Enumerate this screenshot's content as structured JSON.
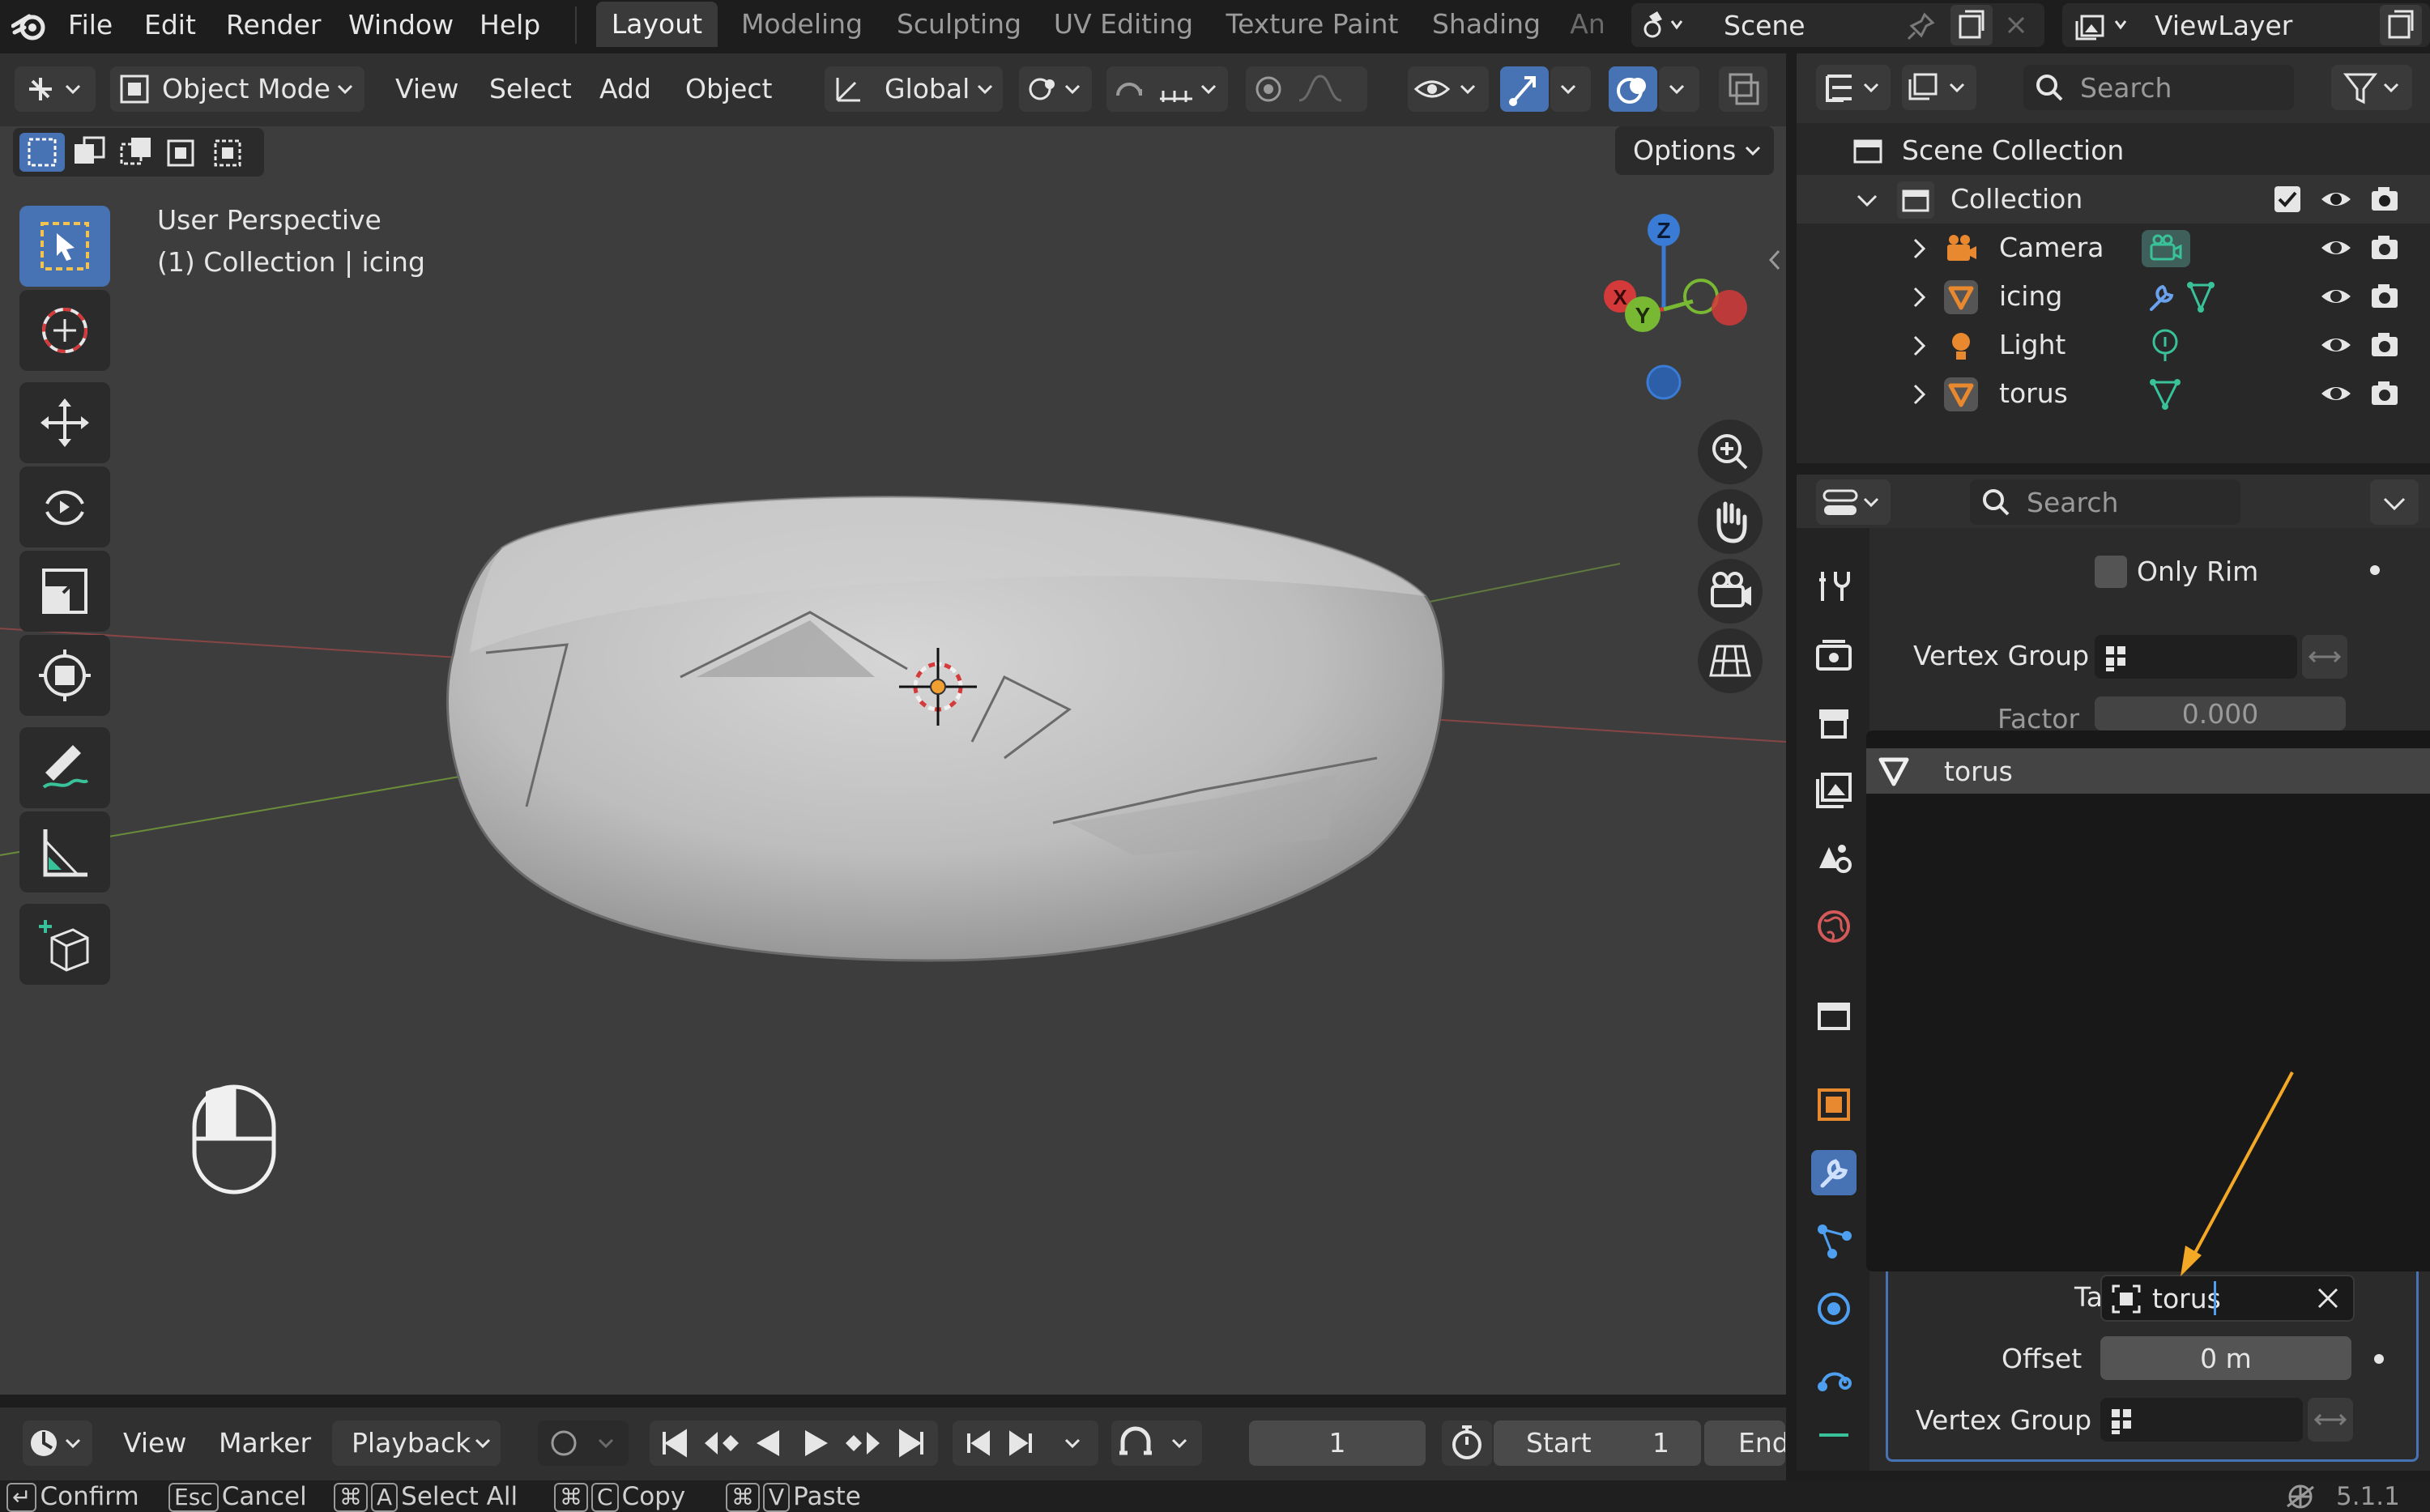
{
  "topbar": {
    "menus": [
      "File",
      "Edit",
      "Render",
      "Window",
      "Help"
    ],
    "workspaces": [
      "Layout",
      "Modeling",
      "Sculpting",
      "UV Editing",
      "Texture Paint",
      "Shading",
      "An"
    ],
    "scene_label": "Scene",
    "viewlayer_label": "ViewLayer"
  },
  "viewport_header": {
    "mode": "Object Mode",
    "menus": [
      "View",
      "Select",
      "Add",
      "Object"
    ],
    "orientation": "Global",
    "options": "Options"
  },
  "viewport": {
    "perspective": "User Perspective",
    "context": "(1) Collection | icing",
    "gizmo": {
      "z": "Z",
      "x": "X",
      "y": "Y"
    }
  },
  "outliner": {
    "search_placeholder": "Search",
    "scene_collection": "Scene Collection",
    "collection": "Collection",
    "items": [
      {
        "name": "Camera",
        "icon": "camera-object-icon",
        "data_icon": "camera-data-icon"
      },
      {
        "name": "icing",
        "icon": "mesh-object-icon",
        "data_icon": "modifier-wrench-icon"
      },
      {
        "name": "Light",
        "icon": "light-object-icon",
        "data_icon": "light-data-icon"
      },
      {
        "name": "torus",
        "icon": "mesh-object-icon",
        "data_icon": "mesh-data-icon"
      }
    ]
  },
  "properties": {
    "search_placeholder": "Search",
    "only_rim": "Only Rim",
    "vertex_group": "Vertex Group",
    "factor_label": "Factor",
    "factor_value": "0.000",
    "dropdown_item": "torus",
    "target_label": "Target",
    "target_value": "torus",
    "offset_label": "Offset",
    "offset_value": "0 m",
    "vertex_group_2": "Vertex Group"
  },
  "timeline": {
    "menus": [
      "View",
      "Marker",
      "Playback"
    ],
    "current_frame": "1",
    "start_label": "Start",
    "start_value": "1",
    "end_label": "End"
  },
  "statusbar": {
    "confirm": "Confirm",
    "cancel_key": "Esc",
    "cancel": "Cancel",
    "cmd": "⌘",
    "a_key": "A",
    "select_all": "Select All",
    "c_key": "C",
    "copy": "Copy",
    "v_key": "V",
    "paste": "Paste",
    "version": "5.1.1"
  },
  "colors": {
    "accent": "#4772b3",
    "object_orange": "#e8882f",
    "data_green": "#39c29a",
    "arrow_yellow": "#f3a925"
  }
}
